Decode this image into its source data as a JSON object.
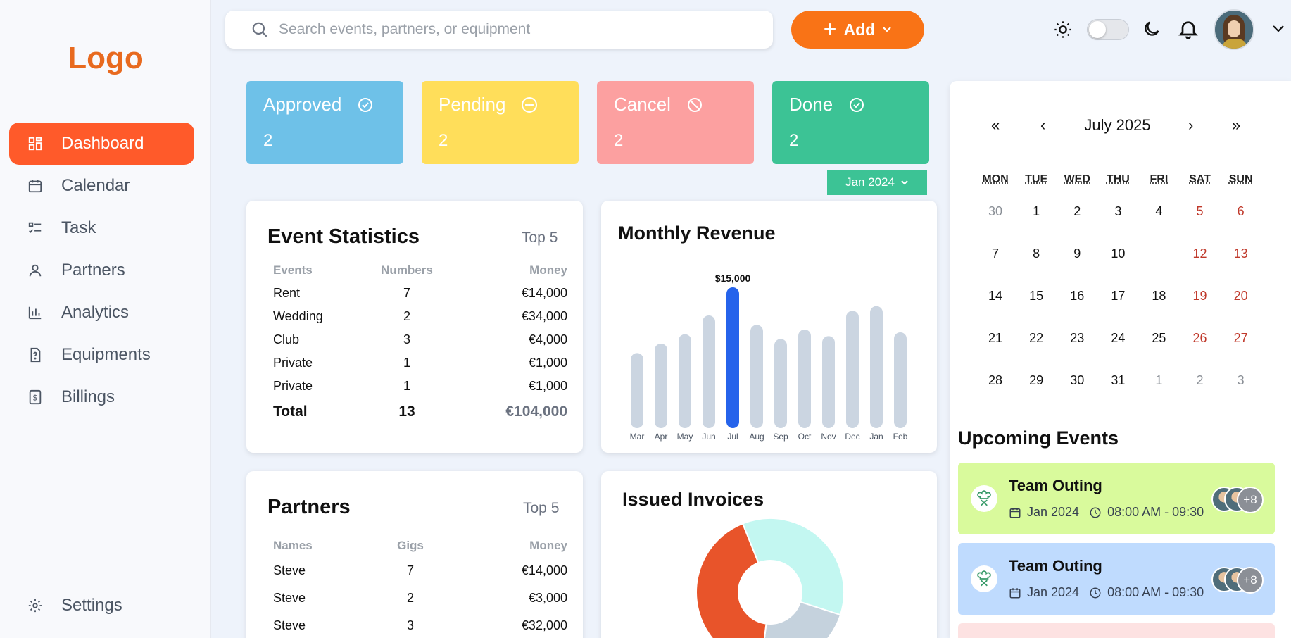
{
  "app": {
    "logo": "Logo"
  },
  "sidebar": {
    "items": [
      {
        "label": "Dashboard",
        "icon": "dashboard-icon",
        "active": true
      },
      {
        "label": "Calendar",
        "icon": "calendar-icon"
      },
      {
        "label": "Task",
        "icon": "task-icon"
      },
      {
        "label": "Partners",
        "icon": "user-icon"
      },
      {
        "label": "Analytics",
        "icon": "analytics-icon"
      },
      {
        "label": "Equipments",
        "icon": "equipment-icon"
      },
      {
        "label": "Billings",
        "icon": "billing-icon"
      }
    ],
    "settings": "Settings"
  },
  "topbar": {
    "search_placeholder": "Search events, partners, or equipment",
    "add_label": "Add",
    "theme_dark": false
  },
  "status": {
    "approved": {
      "label": "Approved",
      "count": "2",
      "color": "#6ec1e8"
    },
    "pending": {
      "label": "Pending",
      "count": "2",
      "color": "#ffde5a"
    },
    "cancel": {
      "label": "Cancel",
      "count": "2",
      "color": "#fca0a0"
    },
    "done": {
      "label": "Done",
      "count": "2",
      "color": "#3cc395"
    },
    "period": "Jan 2024"
  },
  "event_stats": {
    "title": "Event Statistics",
    "subtitle": "Top 5",
    "headers": [
      "Events",
      "Numbers",
      "Money"
    ],
    "rows": [
      [
        "Rent",
        "7",
        "€14,000"
      ],
      [
        "Wedding",
        "2",
        "€34,000"
      ],
      [
        "Club",
        "3",
        "€4,000"
      ],
      [
        "Private",
        "1",
        "€1,000"
      ],
      [
        "Private",
        "1",
        "€1,000"
      ]
    ],
    "total": [
      "Total",
      "13",
      "€104,000"
    ]
  },
  "revenue": {
    "title": "Monthly Revenue",
    "highlight_label": "$15,000"
  },
  "partners": {
    "title": "Partners",
    "subtitle": "Top 5",
    "headers": [
      "Names",
      "Gigs",
      "Money"
    ],
    "rows": [
      [
        "Steve",
        "7",
        "€14,000"
      ],
      [
        "Steve",
        "2",
        "€3,000"
      ],
      [
        "Steve",
        "3",
        "€32,000"
      ]
    ]
  },
  "invoices": {
    "title": "Issued Invoices"
  },
  "calendar": {
    "nav": [
      "«",
      "‹",
      "›",
      "»"
    ],
    "month": "July 2025",
    "dow": [
      "MON",
      "TUE",
      "WED",
      "THU",
      "FRI",
      "SAT",
      "SUN"
    ],
    "weeks": [
      [
        "30",
        "1",
        "2",
        "3",
        "4",
        "5",
        "6"
      ],
      [
        "7",
        "8",
        "9",
        "10",
        "",
        "12",
        "13"
      ],
      [
        "14",
        "15",
        "16",
        "17",
        "18",
        "19",
        "20"
      ],
      [
        "21",
        "22",
        "23",
        "24",
        "25",
        "26",
        "27"
      ],
      [
        "28",
        "29",
        "30",
        "31",
        "1",
        "2",
        "3"
      ]
    ]
  },
  "upcoming": {
    "title": "Upcoming Events",
    "events": [
      {
        "title": "Team Outing",
        "date": "Jan 2024",
        "time": "08:00 AM - 09:30",
        "more": "+8",
        "color": "#d9fa9c"
      },
      {
        "title": "Team Outing",
        "date": "Jan 2024",
        "time": "08:00 AM - 09:30",
        "more": "+8",
        "color": "#bfdbfe"
      },
      {
        "title": "",
        "date": "",
        "time": "",
        "more": "",
        "color": "#fde2e2"
      }
    ]
  },
  "chart_data": [
    {
      "type": "bar",
      "title": "Monthly Revenue",
      "categories": [
        "Mar",
        "Apr",
        "May",
        "Jun",
        "Jul",
        "Aug",
        "Sep",
        "Oct",
        "Nov",
        "Dec",
        "Jan",
        "Feb"
      ],
      "values": [
        8000,
        9000,
        10000,
        12000,
        15000,
        11000,
        9500,
        10500,
        9800,
        12500,
        13000,
        10200
      ],
      "highlight_index": 4,
      "bar_color": "#cbd5e1",
      "highlight_color": "#2563eb",
      "ylim": [
        0,
        15000
      ]
    },
    {
      "type": "pie",
      "title": "Issued Invoices",
      "slices": [
        {
          "label": "",
          "value": 42,
          "color": "#e8542a"
        },
        {
          "label": "",
          "value": 36,
          "color": "#c3f7f1"
        },
        {
          "label": "",
          "value": 22,
          "color": "#c5d2dd"
        }
      ],
      "donut": true
    }
  ]
}
